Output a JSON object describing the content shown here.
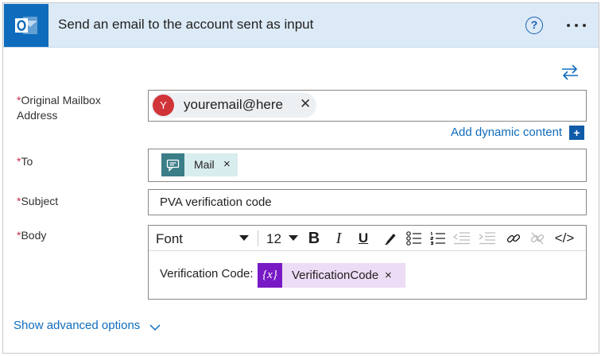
{
  "header": {
    "title": "Send an email to the account sent as input",
    "help_label": "?"
  },
  "mailbox": {
    "label": "Original Mailbox Address",
    "token": {
      "initial": "Y",
      "text": "youremail@here",
      "remove": "✕"
    }
  },
  "dynamic_content": {
    "label": "Add dynamic content",
    "plus": "+"
  },
  "to": {
    "label": "To",
    "token": {
      "text": "Mail",
      "remove": "×"
    }
  },
  "subject": {
    "label": "Subject",
    "value": "PVA verification code"
  },
  "body": {
    "label": "Body",
    "toolbar": {
      "font": "Font",
      "size": "12",
      "bold": "B",
      "italic": "I",
      "underline": "U",
      "code": "</>"
    },
    "text": "Verification Code:",
    "token": {
      "icon": "{x}",
      "text": "VerificationCode",
      "remove": "×"
    }
  },
  "required_marker": "*",
  "advanced": {
    "label": "Show advanced options"
  },
  "icons": {
    "app": "outlook-icon",
    "help": "help-circle-icon",
    "more": "more-icon",
    "swap": "swap-icon",
    "mail_token": "chat-icon",
    "var_token": "variable-icon"
  },
  "colors": {
    "accent": "#0f6cbd",
    "header_bg": "#dceaf7",
    "avatar": "#d13438",
    "variable": "#7719c4",
    "mail": "#3b7e88"
  }
}
